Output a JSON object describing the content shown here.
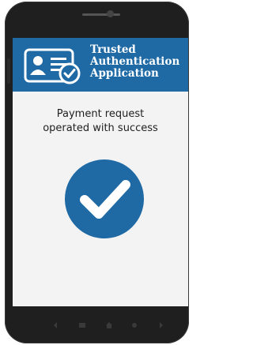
{
  "header": {
    "title_lines": [
      "Trusted",
      "Authentication",
      "Application"
    ],
    "icon": "id-card-check-icon"
  },
  "main": {
    "message_lines": [
      "Payment request",
      "operated with success"
    ],
    "status_icon": "success-checkmark-icon"
  },
  "nav": {
    "icons": [
      "back-icon",
      "menu-icon",
      "home-icon",
      "search-icon",
      "forward-icon"
    ]
  },
  "colors": {
    "brand": "#1f6aa5",
    "screen_bg": "#f3f3f3",
    "phone_body": "#1f1f1f"
  }
}
